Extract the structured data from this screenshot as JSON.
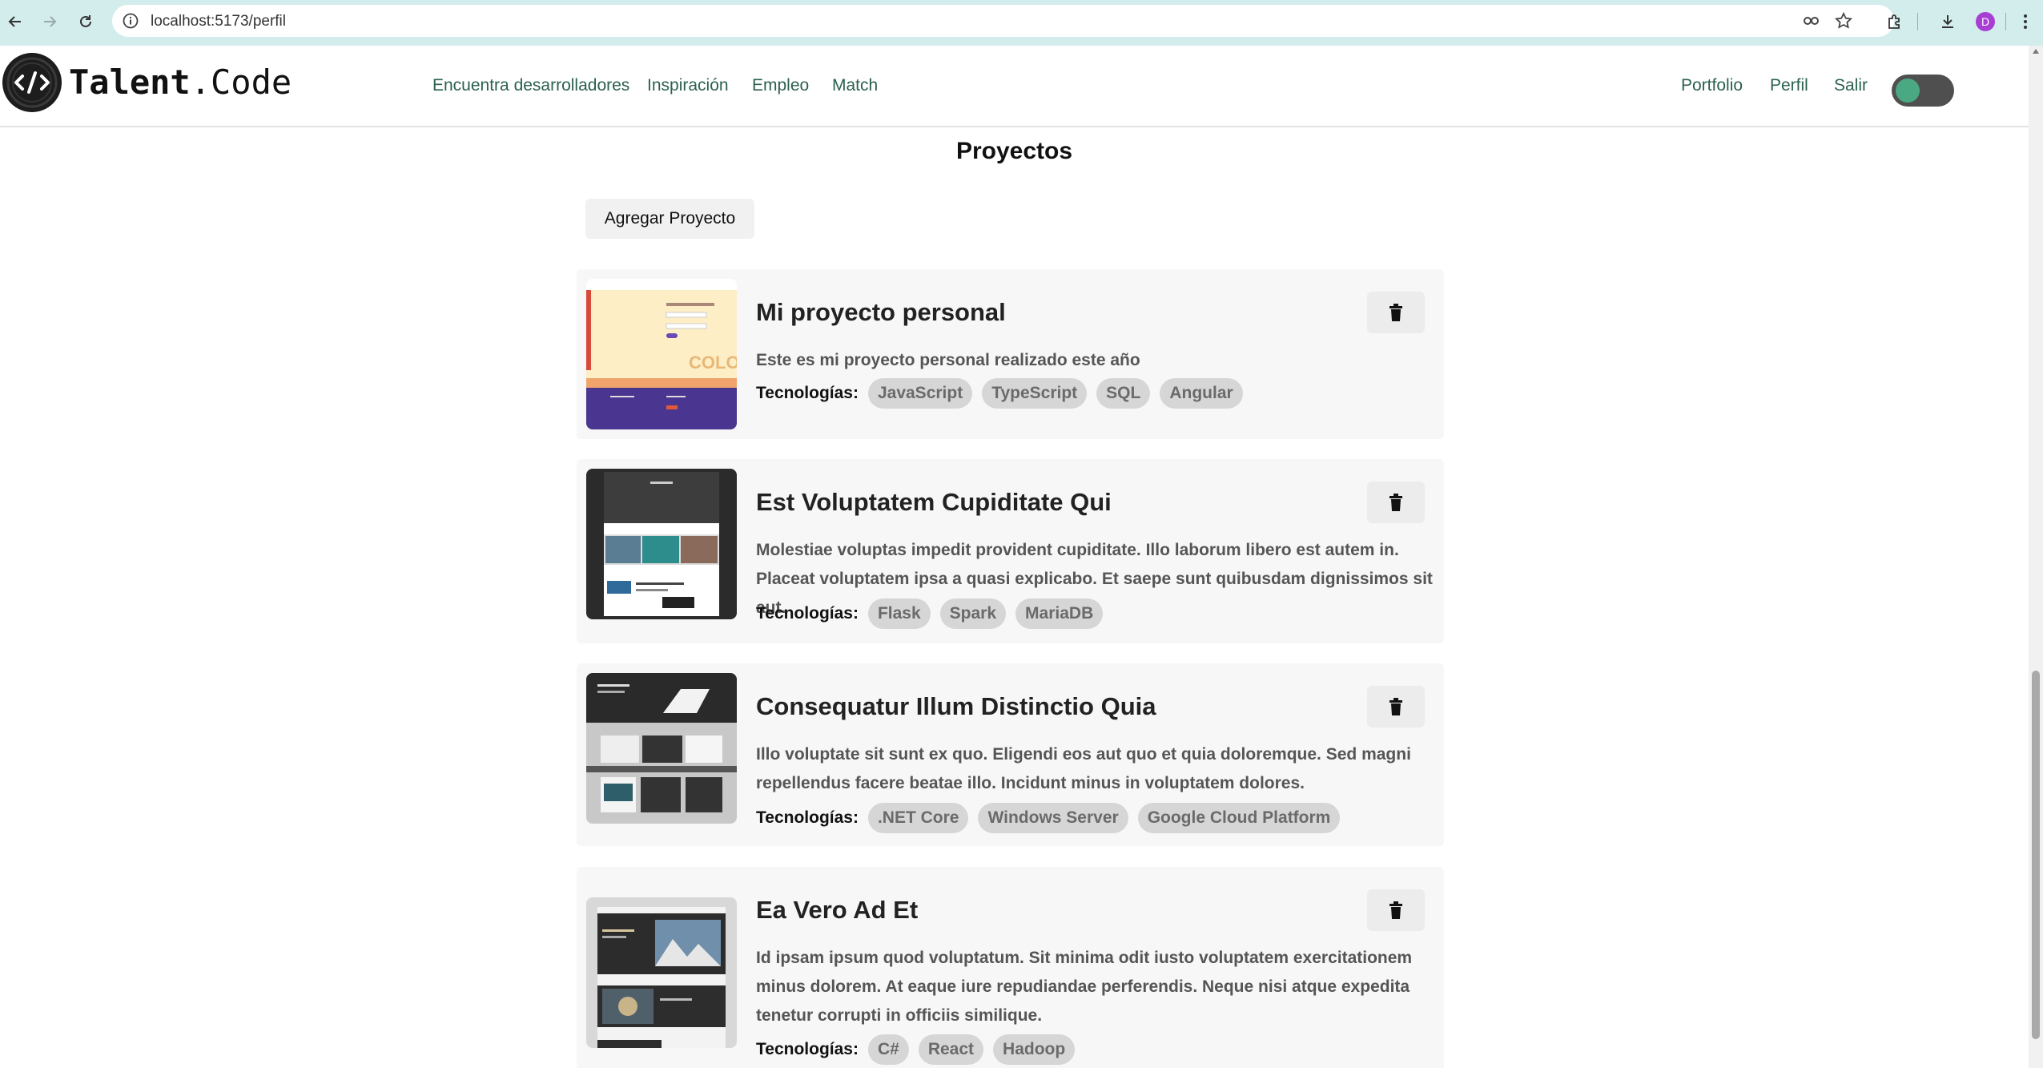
{
  "browser": {
    "url": "localhost:5173/perfil",
    "profile_initial": "D"
  },
  "header": {
    "logo_bold": "Talent",
    "logo_rest": ".Code",
    "nav": [
      {
        "label": "Encuentra desarrolladores"
      },
      {
        "label": "Inspiración"
      },
      {
        "label": "Empleo"
      },
      {
        "label": "Match"
      }
    ],
    "right_nav": [
      {
        "label": "Portfolio"
      },
      {
        "label": "Perfil"
      },
      {
        "label": "Salir"
      }
    ],
    "theme_toggle": {
      "state": "off"
    }
  },
  "main": {
    "title": "Proyectos",
    "add_button": "Agregar Proyecto",
    "tech_label": "Tecnologías:",
    "projects": [
      {
        "title": "Mi proyecto personal",
        "description": "Este es mi proyecto personal realizado este año",
        "technologies": [
          "JavaScript",
          "TypeScript",
          "SQL",
          "Angular"
        ]
      },
      {
        "title": "Est Voluptatem Cupiditate Qui",
        "description": "Molestiae voluptas impedit provident cupiditate. Illo laborum libero est autem in. Placeat voluptatem ipsa a quasi explicabo. Et saepe sunt quibusdam dignissimos sit aut.",
        "technologies": [
          "Flask",
          "Spark",
          "MariaDB"
        ]
      },
      {
        "title": "Consequatur Illum Distinctio Quia",
        "description": "Illo voluptate sit sunt ex quo. Eligendi eos aut quo et quia doloremque. Sed magni repellendus facere beatae illo. Incidunt minus in voluptatem dolores.",
        "technologies": [
          ".NET Core",
          "Windows Server",
          "Google Cloud Platform"
        ]
      },
      {
        "title": "Ea Vero Ad Et",
        "description": "Id ipsam ipsum quod voluptatum. Sit minima odit iusto voluptatem exercitationem minus dolorem. At eaque iure repudiandae perferendis. Neque nisi atque expedita tenetur corrupti in officiis similique.",
        "technologies": [
          "C#",
          "React",
          "Hadoop"
        ]
      }
    ]
  },
  "icons": {
    "back": "arrow-left-icon",
    "forward": "arrow-right-icon",
    "reload": "reload-icon",
    "info": "info-icon",
    "password": "key-icon",
    "bookmark": "star-icon",
    "extensions": "puzzle-icon",
    "downloads": "download-icon",
    "delete": "trash-icon"
  },
  "colors": {
    "chrome": "#d3ecec",
    "nav_link": "#2b6150",
    "toggle_track": "#4f4f4f",
    "toggle_knob": "#4aa882",
    "card_bg": "#f7f7f7",
    "tag_bg": "#d6d6d6"
  }
}
